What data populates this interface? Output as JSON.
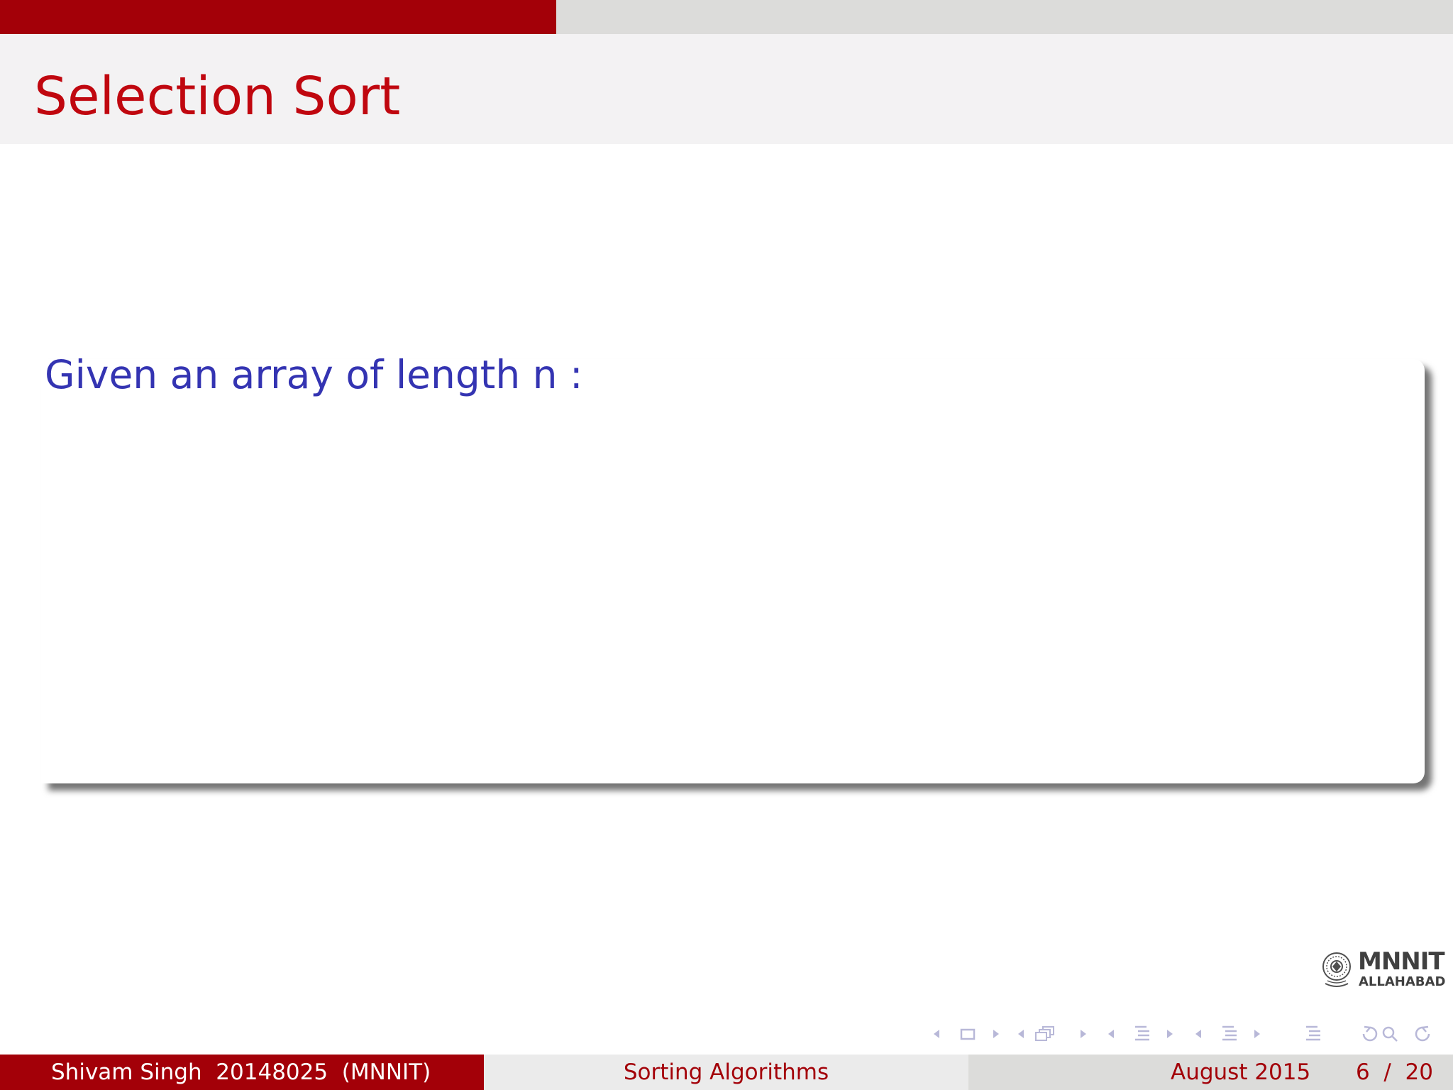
{
  "slide": {
    "title": "Selection Sort",
    "body_text": "Given an array of length n :",
    "progress_fraction": 0.3
  },
  "logo": {
    "main": "MNNIT",
    "sub": "ALLAHABAD",
    "seal_icon": "institute-seal-icon"
  },
  "navigation": {
    "icons": [
      "slide-prev-icon",
      "slide-icon",
      "slide-next-icon",
      "frame-prev-icon",
      "frame-icon",
      "frame-next-icon",
      "subsection-prev-icon",
      "subsection-icon",
      "subsection-next-icon",
      "section-prev-icon",
      "section-icon",
      "section-next-icon",
      "document-icon",
      "back-icon",
      "search-icon",
      "forward-icon"
    ]
  },
  "footer": {
    "author": "Shivam Singh  20148025  (MNNIT)",
    "title": "Sorting Algorithms",
    "date": "August 2015",
    "page": "6  /  20"
  },
  "colors": {
    "accent_red": "#a30008",
    "title_red": "#c0070f",
    "body_blue": "#3434b2",
    "title_band": "#f3f2f3",
    "footer_gray": "#dcdcda"
  }
}
